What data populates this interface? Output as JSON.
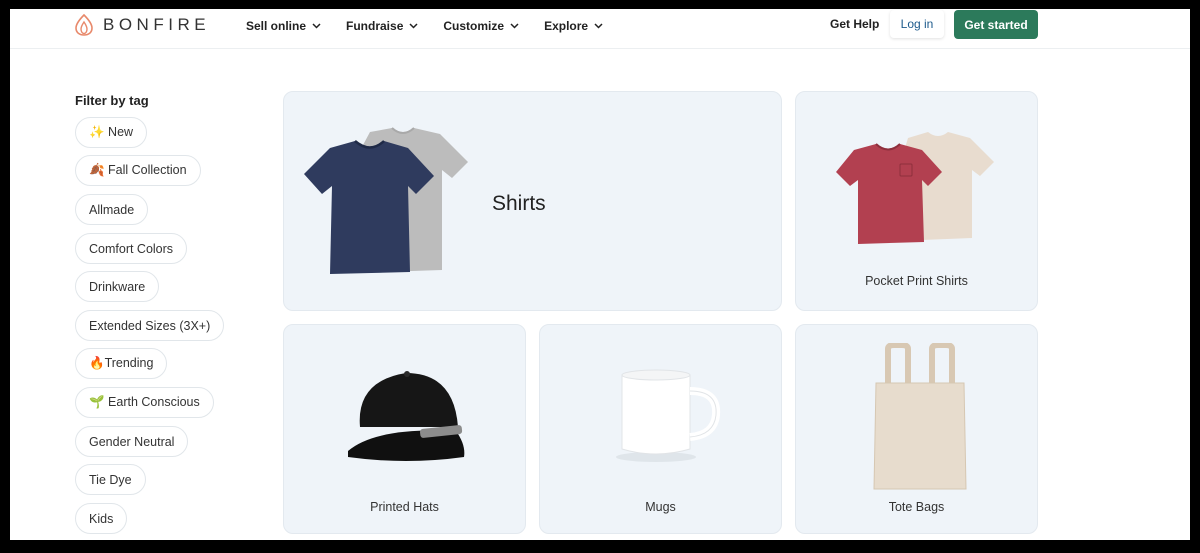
{
  "brand": {
    "name": "BONFIRE",
    "accent": "#2c7a5b",
    "logo_color": "#e8896b"
  },
  "nav": [
    {
      "label": "Sell online",
      "icon": "chevron-down-icon"
    },
    {
      "label": "Fundraise",
      "icon": "chevron-down-icon"
    },
    {
      "label": "Customize",
      "icon": "chevron-down-icon"
    },
    {
      "label": "Explore",
      "icon": "chevron-down-icon"
    }
  ],
  "header_actions": {
    "help": "Get Help",
    "login": "Log in",
    "get_started": "Get started"
  },
  "sidebar": {
    "title": "Filter by tag",
    "tags": [
      {
        "label": "✨ New"
      },
      {
        "label": "🍂 Fall Collection"
      },
      {
        "label": "Allmade"
      },
      {
        "label": "Comfort Colors"
      },
      {
        "label": "Drinkware"
      },
      {
        "label": "Extended Sizes (3X+)"
      },
      {
        "label": "🔥Trending"
      },
      {
        "label": "🌱 Earth Conscious"
      },
      {
        "label": "Gender Neutral"
      },
      {
        "label": "Tie Dye"
      },
      {
        "label": "Kids"
      }
    ]
  },
  "products": [
    {
      "label": "Shirts",
      "icon": "tshirt-stack-icon"
    },
    {
      "label": "Pocket Print Shirts",
      "icon": "pocket-tshirt-icon"
    },
    {
      "label": "Printed Hats",
      "icon": "cap-icon"
    },
    {
      "label": "Mugs",
      "icon": "mug-icon"
    },
    {
      "label": "Tote Bags",
      "icon": "tote-bag-icon"
    }
  ]
}
